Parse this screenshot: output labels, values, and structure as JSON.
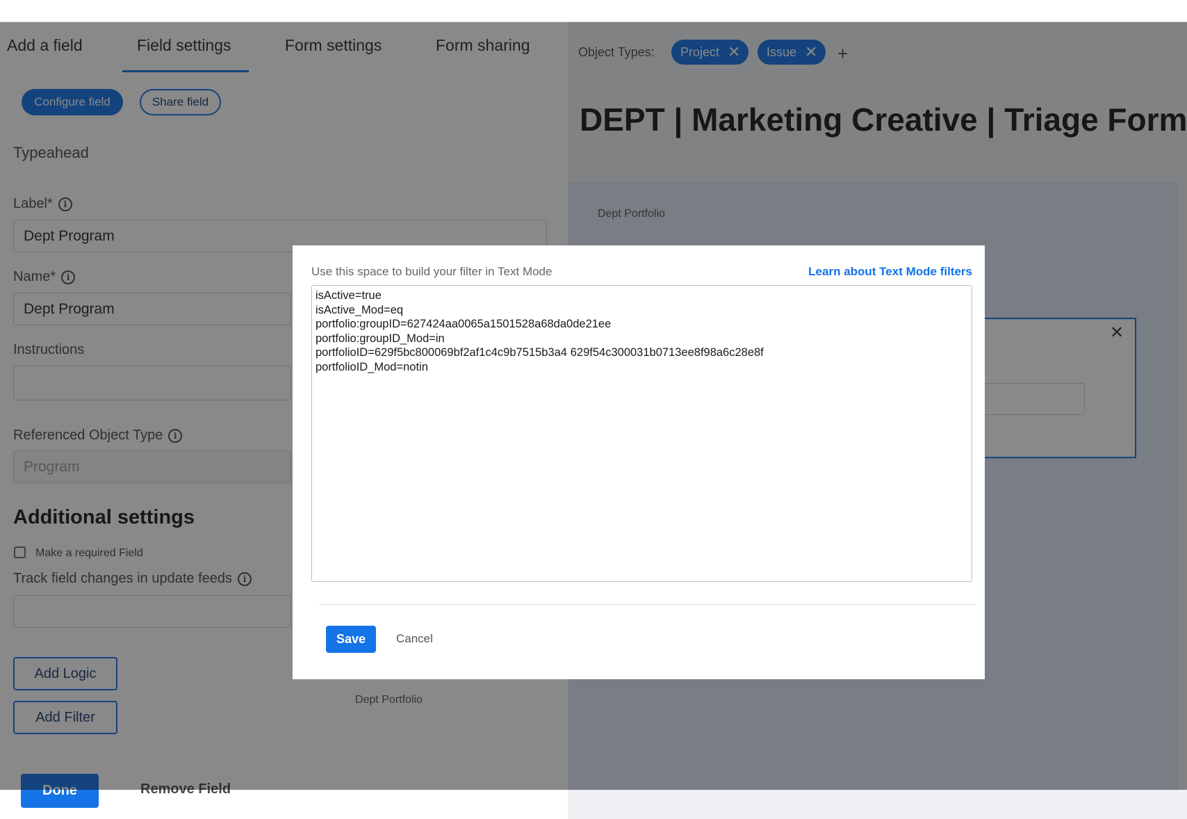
{
  "tabs": [
    "Add a field",
    "Field settings",
    "Form settings",
    "Form sharing"
  ],
  "left": {
    "configure_btn": "Configure field",
    "share_btn": "Share field",
    "field_type": "Typeahead",
    "label_label": "Label*",
    "label_value": "Dept Program",
    "name_label": "Name*",
    "name_value": "Dept Program",
    "instructions_label": "Instructions",
    "ref_type_label": "Referenced Object Type",
    "ref_type_value": "Program",
    "additional_heading": "Additional settings",
    "required_checkbox": "Make a required Field",
    "track_label": "Track field changes in update feeds",
    "add_logic": "Add Logic",
    "add_filter": "Add Filter",
    "done": "Done",
    "remove_field": "Remove Field",
    "dept_portfolio_footer": "Dept Portfolio"
  },
  "right": {
    "object_types_label": "Object Types:",
    "chips": [
      "Project",
      "Issue"
    ],
    "form_title": "DEPT | Marketing Creative | Triage Form",
    "dept_portfolio": "Dept Portfolio"
  },
  "modal": {
    "hint": "Use this space to build your filter in Text Mode",
    "learn_link": "Learn about Text Mode filters",
    "filter_text": "isActive=true\nisActive_Mod=eq\nportfolio:groupID=627424aa0065a1501528a68da0de21ee\nportfolio:groupID_Mod=in\nportfolioID=629f5bc800069bf2af1c4c9b7515b3a4\t629f54c300031b0713ee8f98a6c28e8f\nportfolioID_Mod=notin",
    "save": "Save",
    "cancel": "Cancel"
  },
  "colors": {
    "accent": "#1473e6",
    "overlay": "rgba(20,20,20,0.5)"
  }
}
